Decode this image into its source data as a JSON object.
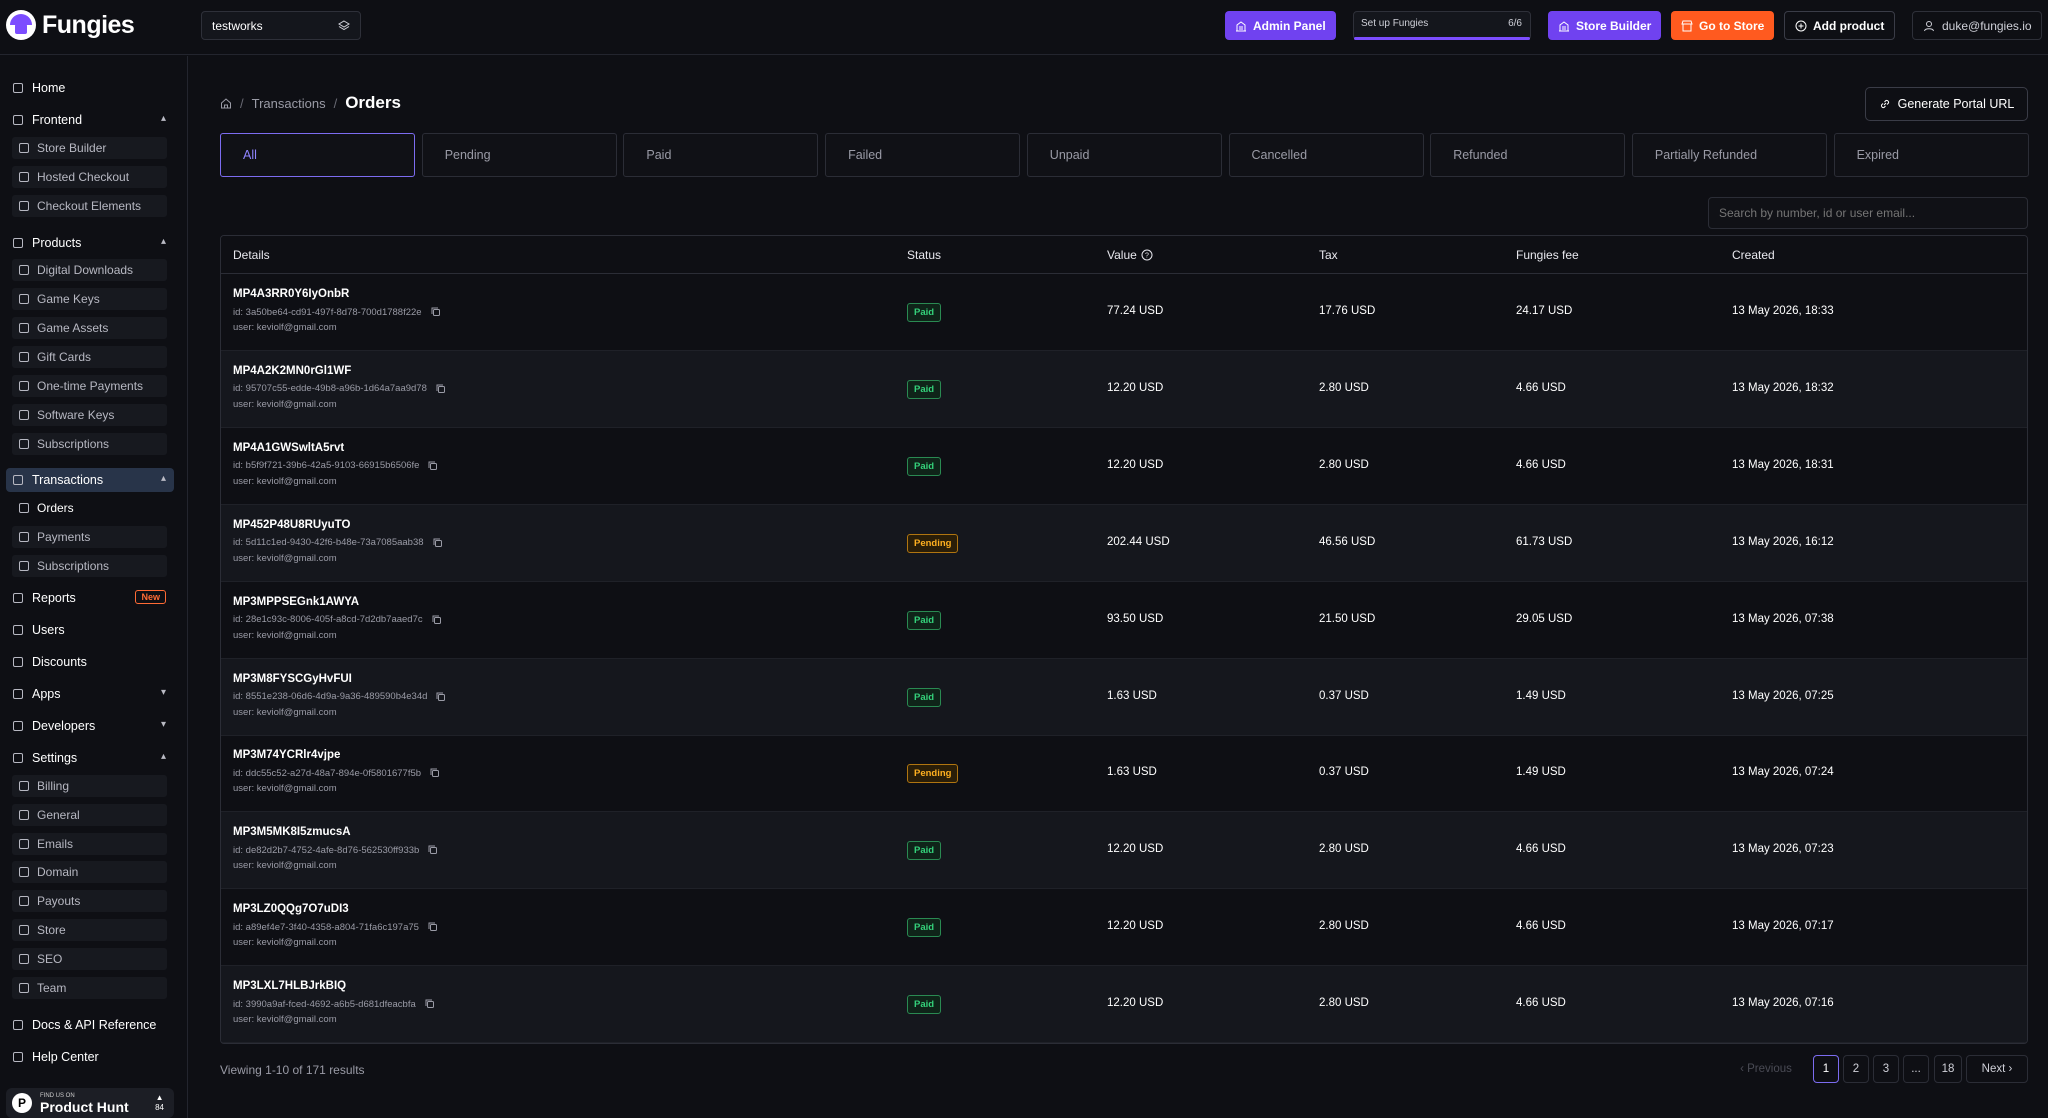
{
  "app": {
    "name": "Fungies"
  },
  "topbar": {
    "store": "testworks",
    "admin_panel": "Admin Panel",
    "setup_label": "Set up Fungies",
    "setup_count": "6/6",
    "setup_progress": 1.0,
    "store_builder": "Store Builder",
    "go_to_store": "Go to Store",
    "add_product": "Add product",
    "user_email": "duke@fungies.io"
  },
  "sidebar": {
    "home": "Home",
    "frontend": "Frontend",
    "frontend_items": [
      "Store Builder",
      "Hosted Checkout",
      "Checkout Elements"
    ],
    "products": "Products",
    "products_items": [
      "Digital Downloads",
      "Game Keys",
      "Game Assets",
      "Gift Cards",
      "One-time Payments",
      "Software Keys",
      "Subscriptions"
    ],
    "transactions": "Transactions",
    "transactions_items": [
      "Orders",
      "Payments",
      "Subscriptions"
    ],
    "reports": "Reports",
    "reports_badge": "New",
    "users": "Users",
    "discounts": "Discounts",
    "apps": "Apps",
    "developers": "Developers",
    "settings": "Settings",
    "settings_items": [
      "Billing",
      "General",
      "Emails",
      "Domain",
      "Payouts",
      "Store",
      "SEO",
      "Team"
    ],
    "docs": "Docs & API Reference",
    "help": "Help Center",
    "product_hunt": {
      "small": "FIND US ON",
      "big": "Product Hunt",
      "votes": "84"
    }
  },
  "page": {
    "breadcrumb_parent": "Transactions",
    "title": "Orders",
    "portal_button": "Generate Portal URL",
    "search_placeholder": "Search by number, id or user email..."
  },
  "tabs": [
    "All",
    "Pending",
    "Paid",
    "Failed",
    "Unpaid",
    "Cancelled",
    "Refunded",
    "Partially Refunded",
    "Expired"
  ],
  "table": {
    "columns": [
      "Details",
      "Status",
      "Value",
      "Tax",
      "Fungies fee",
      "Created"
    ],
    "rows": [
      {
        "number": "MP4A3RR0Y6IyOnbR",
        "id": "id: 3a50be64-cd91-497f-8d78-700d1788f22e",
        "user": "user: keviolf@gmail.com",
        "status": "Paid",
        "value": "77.24 USD",
        "tax": "17.76 USD",
        "fee": "24.17 USD",
        "created": "13 May 2026, 18:33"
      },
      {
        "number": "MP4A2K2MN0rGl1WF",
        "id": "id: 95707c55-edde-49b8-a96b-1d64a7aa9d78",
        "user": "user: keviolf@gmail.com",
        "status": "Paid",
        "value": "12.20 USD",
        "tax": "2.80 USD",
        "fee": "4.66 USD",
        "created": "13 May 2026, 18:32"
      },
      {
        "number": "MP4A1GWSwltA5rvt",
        "id": "id: b5f9f721-39b6-42a5-9103-66915b6506fe",
        "user": "user: keviolf@gmail.com",
        "status": "Paid",
        "value": "12.20 USD",
        "tax": "2.80 USD",
        "fee": "4.66 USD",
        "created": "13 May 2026, 18:31"
      },
      {
        "number": "MP452P48U8RUyuTO",
        "id": "id: 5d11c1ed-9430-42f6-b48e-73a7085aab38",
        "user": "user: keviolf@gmail.com",
        "status": "Pending",
        "value": "202.44 USD",
        "tax": "46.56 USD",
        "fee": "61.73 USD",
        "created": "13 May 2026, 16:12"
      },
      {
        "number": "MP3MPPSEGnk1AWYA",
        "id": "id: 28e1c93c-8006-405f-a8cd-7d2db7aaed7c",
        "user": "user: keviolf@gmail.com",
        "status": "Paid",
        "value": "93.50 USD",
        "tax": "21.50 USD",
        "fee": "29.05 USD",
        "created": "13 May 2026, 07:38"
      },
      {
        "number": "MP3M8FYSCGyHvFUI",
        "id": "id: 8551e238-06d6-4d9a-9a36-489590b4e34d",
        "user": "user: keviolf@gmail.com",
        "status": "Paid",
        "value": "1.63 USD",
        "tax": "0.37 USD",
        "fee": "1.49 USD",
        "created": "13 May 2026, 07:25"
      },
      {
        "number": "MP3M74YCRlr4vjpe",
        "id": "id: ddc55c52-a27d-48a7-894e-0f5801677f5b",
        "user": "user: keviolf@gmail.com",
        "status": "Pending",
        "value": "1.63 USD",
        "tax": "0.37 USD",
        "fee": "1.49 USD",
        "created": "13 May 2026, 07:24"
      },
      {
        "number": "MP3M5MK8I5zmucsA",
        "id": "id: de82d2b7-4752-4afe-8d76-562530ff933b",
        "user": "user: keviolf@gmail.com",
        "status": "Paid",
        "value": "12.20 USD",
        "tax": "2.80 USD",
        "fee": "4.66 USD",
        "created": "13 May 2026, 07:23"
      },
      {
        "number": "MP3LZ0QQg7O7uDI3",
        "id": "id: a89ef4e7-3f40-4358-a804-71fa6c197a75",
        "user": "user: keviolf@gmail.com",
        "status": "Paid",
        "value": "12.20 USD",
        "tax": "2.80 USD",
        "fee": "4.66 USD",
        "created": "13 May 2026, 07:17"
      },
      {
        "number": "MP3LXL7HLBJrkBIQ",
        "id": "id: 3990a9af-fced-4692-a6b5-d681dfeacbfa",
        "user": "user: keviolf@gmail.com",
        "status": "Paid",
        "value": "12.20 USD",
        "tax": "2.80 USD",
        "fee": "4.66 USD",
        "created": "13 May 2026, 07:16"
      }
    ]
  },
  "pagination": {
    "summary": "Viewing 1-10 of 171 results",
    "previous": "Previous",
    "pages": [
      "1",
      "2",
      "3",
      "...",
      "18"
    ],
    "next": "Next",
    "current": "1"
  }
}
